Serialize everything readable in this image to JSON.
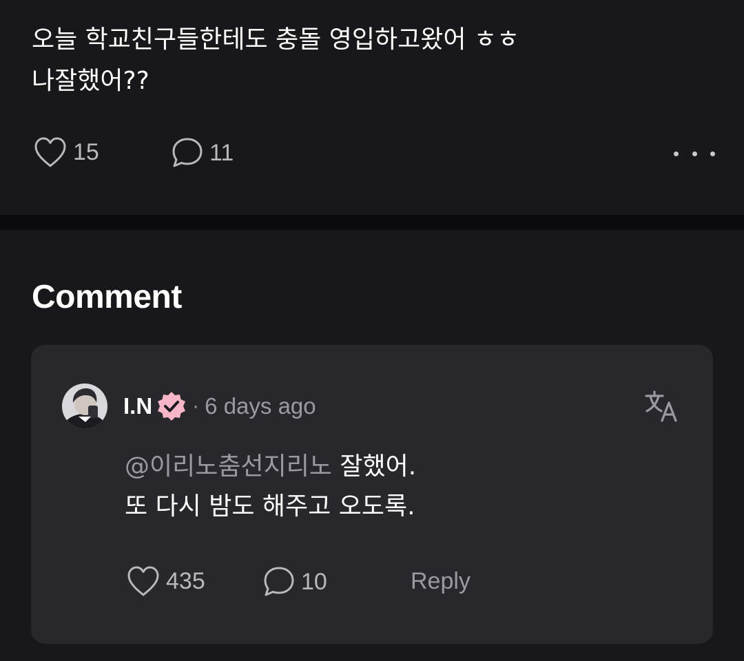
{
  "post": {
    "line1": "오늘 학교친구들한테도 충돌 영입하고왔어 ㅎㅎ",
    "line2": "나잘했어??",
    "likes": "15",
    "comments": "11"
  },
  "comments_section": {
    "heading": "Comment",
    "comment": {
      "author": "I.N",
      "separator": "·",
      "time": "6 days ago",
      "mention": "@이리노춤선지리노",
      "text_line1": " 잘했어.",
      "text_line2": "또 다시 밤도 해주고 오도록.",
      "likes": "435",
      "replies": "10",
      "reply_label": "Reply"
    }
  },
  "colors": {
    "background": "#18181b",
    "card": "#27272c",
    "divider": "#0b0b0d",
    "muted_text": "#9a9aa0",
    "verified_badge": "#f7b6c8"
  }
}
